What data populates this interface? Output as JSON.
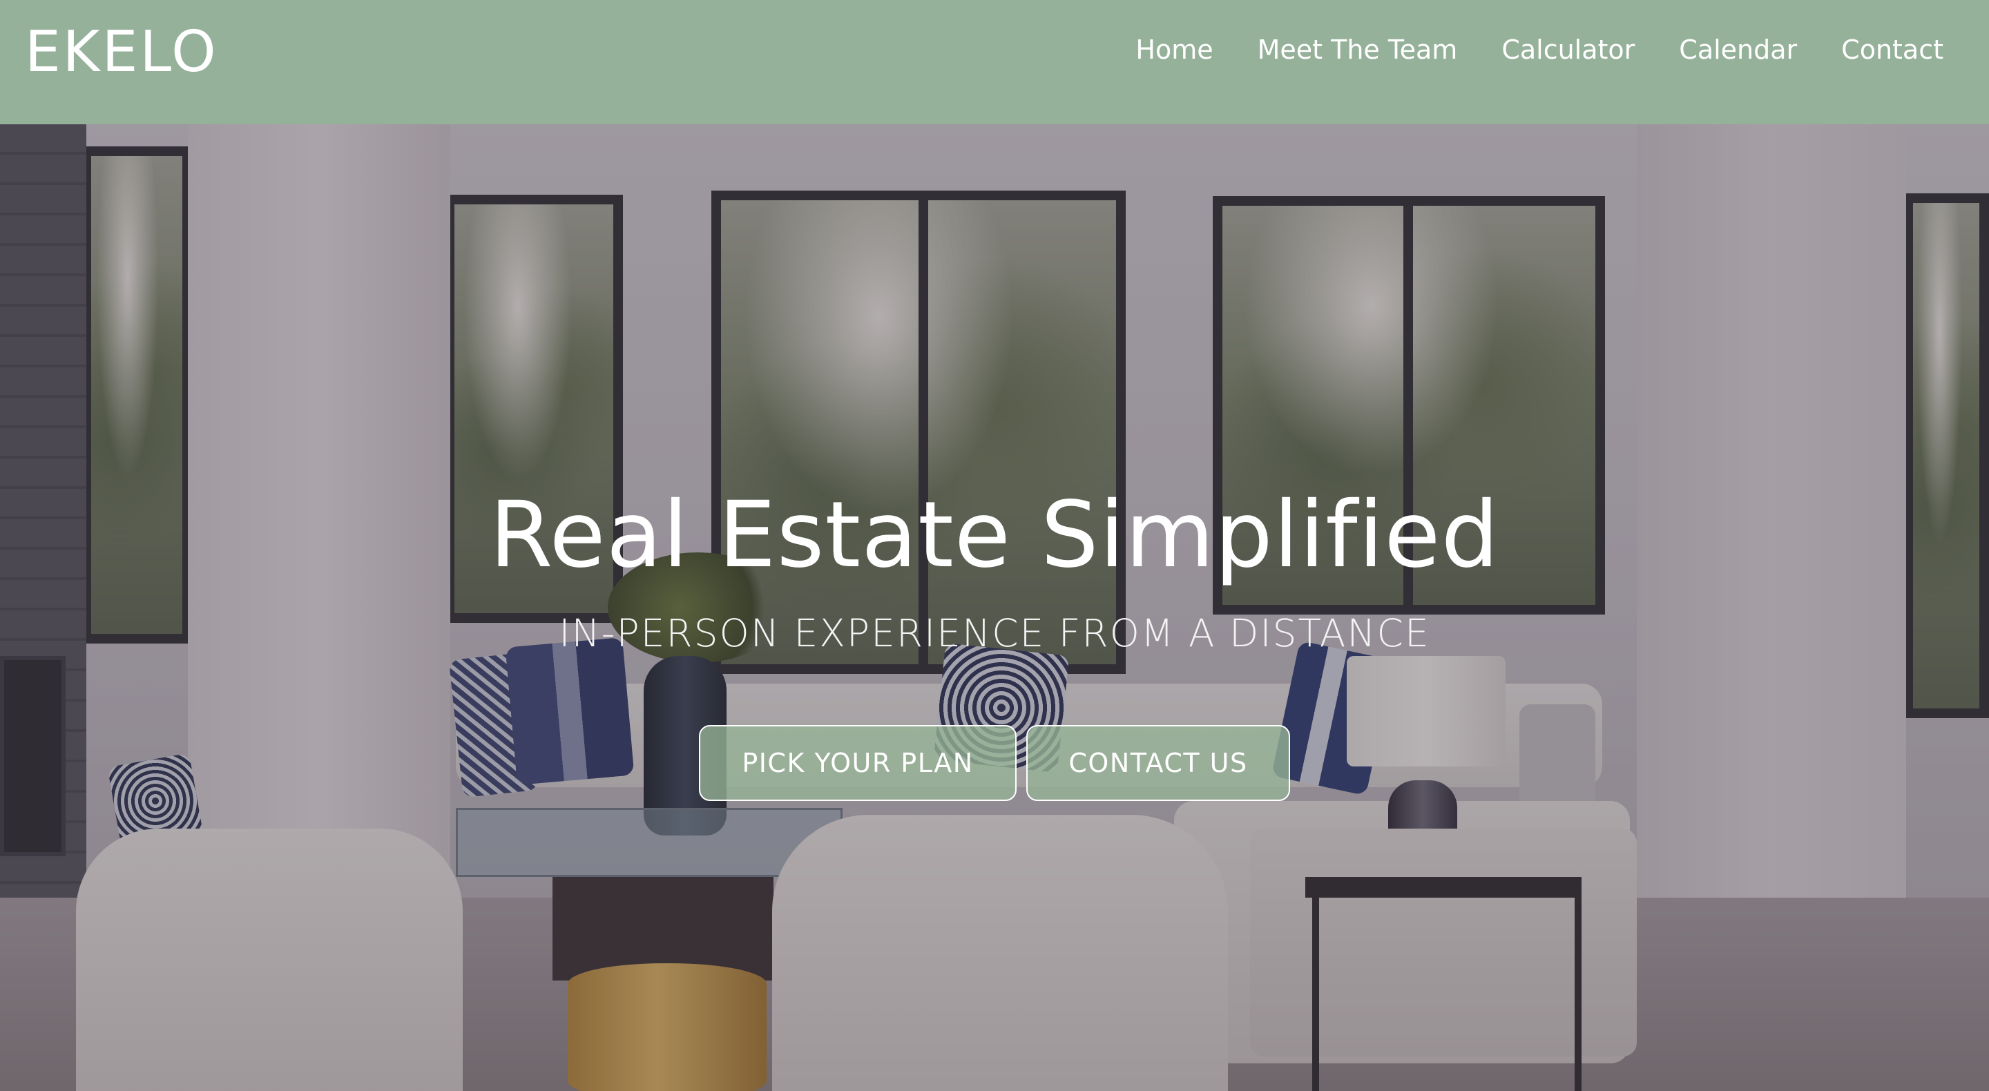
{
  "brand": {
    "logo": "EKELO",
    "navbar_color": "#96b19a"
  },
  "nav": {
    "items": [
      {
        "label": "Home"
      },
      {
        "label": "Meet The Team"
      },
      {
        "label": "Calculator"
      },
      {
        "label": "Calendar"
      },
      {
        "label": "Contact"
      }
    ]
  },
  "hero": {
    "title": "Real Estate Simplified",
    "subtitle": "IN-PERSON EXPERIENCE FROM A DISTANCE",
    "buttons": {
      "plan_label": "PICK YOUR PLAN",
      "contact_label": "CONTACT US"
    },
    "button_color": "#96b496",
    "background_image": "living room interior with large windows"
  }
}
